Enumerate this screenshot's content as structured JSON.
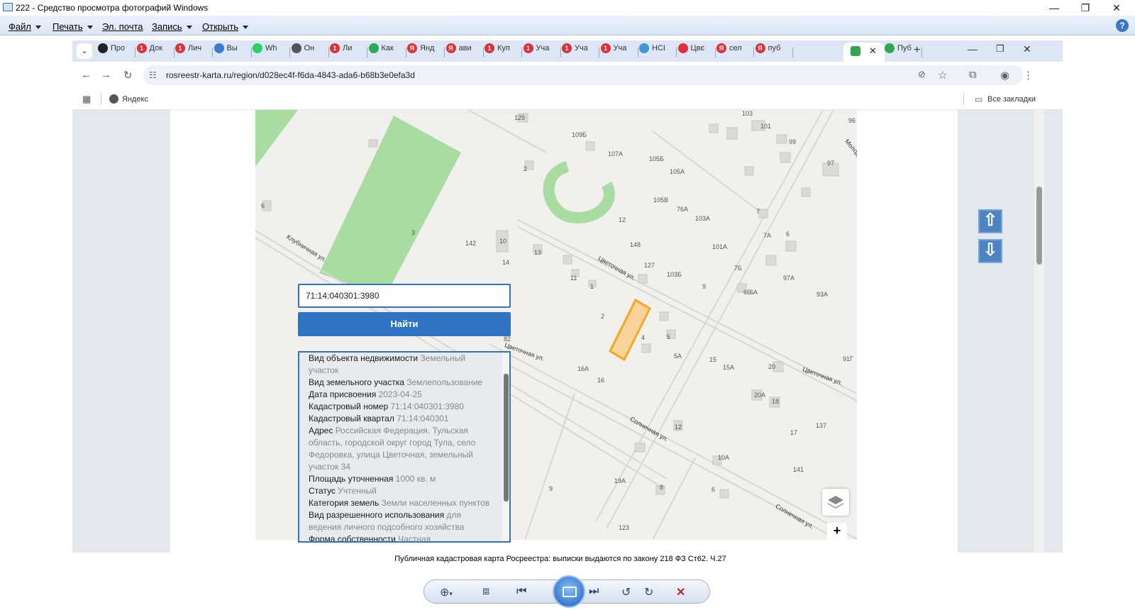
{
  "window": {
    "title": "222 - Средство просмотра фотографий Windows",
    "minimize": "—",
    "restore": "❐",
    "close": "✕"
  },
  "menu": {
    "file": "Файл",
    "print": "Печать",
    "email": "Эл. почта",
    "burn": "Запись",
    "open": "Открыть",
    "help": "?"
  },
  "browser": {
    "tabs": [
      {
        "label": "Про",
        "icon": "notion-icon",
        "color": "#222222"
      },
      {
        "label": "Док",
        "icon": "badge-1-icon",
        "color": "#e0313b"
      },
      {
        "label": "Лич",
        "icon": "badge-1-icon",
        "color": "#e0313b"
      },
      {
        "label": "Вы",
        "icon": "snowflake-icon",
        "color": "#3a7bd5"
      },
      {
        "label": "Wh",
        "icon": "whatsapp-icon",
        "color": "#25d366"
      },
      {
        "label": "Он",
        "icon": "globe-icon",
        "color": "#555555"
      },
      {
        "label": "Ли",
        "icon": "badge-1-icon",
        "color": "#e0313b"
      },
      {
        "label": "Как",
        "icon": "house-icon",
        "color": "#2fa84f"
      },
      {
        "label": "Янд",
        "icon": "yandex-icon",
        "color": "#e0313b"
      },
      {
        "label": "ави",
        "icon": "yandex-icon",
        "color": "#e0313b"
      },
      {
        "label": "Куп",
        "icon": "badge-1-icon",
        "color": "#e0313b"
      },
      {
        "label": "Уча",
        "icon": "badge-1-icon",
        "color": "#e0313b"
      },
      {
        "label": "Уча",
        "icon": "badge-1-icon",
        "color": "#e0313b"
      },
      {
        "label": "Уча",
        "icon": "badge-1-icon",
        "color": "#e0313b"
      },
      {
        "label": "НСІ",
        "icon": "chart-icon",
        "color": "#3a9ad9"
      },
      {
        "label": "Цвє",
        "icon": "pin-icon",
        "color": "#e0313b"
      },
      {
        "label": "сел",
        "icon": "yandex-icon",
        "color": "#e0313b"
      },
      {
        "label": "пуб",
        "icon": "yandex-icon",
        "color": "#e0313b"
      },
      {
        "label": "",
        "icon": "rosreestr-icon",
        "color": "#2fa84f"
      },
      {
        "label": "Пуб",
        "icon": "rosreestr-icon",
        "color": "#2fa84f"
      }
    ],
    "url": "rosreestr-karta.ru/region/d028ec4f-f6da-4843-ada6-b68b3e0efa3d",
    "bookmark_yandex": "Яндекс",
    "all_bookmarks": "Все закладки",
    "new_tab": "+"
  },
  "search": {
    "value": "71:14:040301:3980",
    "button": "Найти"
  },
  "info": [
    {
      "k": "Вид объекта недвижимости",
      "v": "Земельный участок"
    },
    {
      "k": "Вид земельного участка",
      "v": "Землепользование"
    },
    {
      "k": "Дата присвоения",
      "v": "2023-04-25"
    },
    {
      "k": "Кадастровый номер",
      "v": "71:14:040301:3980"
    },
    {
      "k": "Кадастровый квартал",
      "v": "71:14:040301"
    },
    {
      "k": "Адрес",
      "v": "Российская Федерация, Тульская область, городской округ город Тула, село Федоровка, улица Цветочная, земельный участок 34"
    },
    {
      "k": "Площадь уточненная",
      "v": "1000 кв. м"
    },
    {
      "k": "Статус",
      "v": "Учтенный"
    },
    {
      "k": "Категория земель",
      "v": "Земли населенных пунктов"
    },
    {
      "k": "Вид разрешенного использования",
      "v": "для ведения личного подсобного хозяйства"
    },
    {
      "k": "Форма собственности",
      "v": "Частная"
    }
  ],
  "map": {
    "streets": [
      "Клубничная ул.",
      "Цветочная ул.",
      "Цветочная ул.",
      "Солнечная ул.",
      "Солнечная ул.",
      "Цветочная ул.",
      "Молод"
    ],
    "labels": [
      "129",
      "109Б",
      "107А",
      "105Б",
      "105А",
      "103",
      "101",
      "99",
      "97",
      "2",
      "6",
      "3",
      "142",
      "10",
      "13",
      "14",
      "12",
      "148",
      "105В",
      "76А",
      "103А",
      "101А",
      "127",
      "103Б",
      "9",
      "7Б",
      "6Б",
      "6А",
      "97А",
      "93А",
      "7",
      "6",
      "7А",
      "11",
      "1",
      "2",
      "4",
      "5",
      "5А",
      "82",
      "16А",
      "16",
      "15",
      "15А",
      "20",
      "20А",
      "18",
      "12",
      "10А",
      "141",
      "137",
      "17",
      "9",
      "19А",
      "8",
      "6",
      "123",
      "91Г",
      "96"
    ]
  },
  "caption": "Публичная кадастровая карта Росреестра: выписки выдаются по закону 218 ФЗ Ст62. Ч.27",
  "colors": {
    "accent": "#2f73c4",
    "parcel": "#f5a623",
    "map_bg": "#f1f0ec",
    "park": "#a8dca0"
  }
}
